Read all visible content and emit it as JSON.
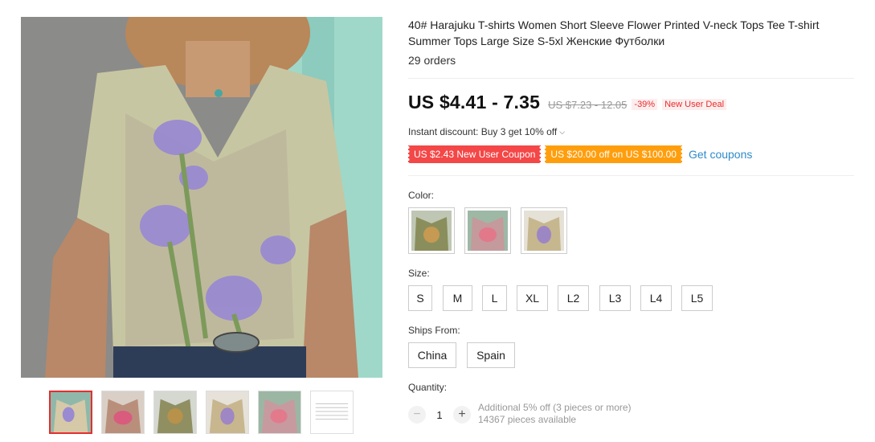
{
  "product": {
    "title": "40# Harajuku T-shirts Women Short Sleeve Flower Printed V-neck Tops Tee T-shirt Summer Tops Large Size S-5xl Женские Футболки",
    "orders": "29 orders"
  },
  "price": {
    "current": "US $4.41 - 7.35",
    "original": "US $7.23 - 12.05",
    "discount": "-39%",
    "deal": "New User Deal"
  },
  "instant_discount": "Instant discount: Buy 3 get 10% off",
  "coupons": {
    "new_user": "US $2.43 New User Coupon",
    "store": "US $20.00 off on US $100.00",
    "get_label": "Get coupons"
  },
  "color": {
    "label": "Color:"
  },
  "size": {
    "label": "Size:",
    "options": [
      "S",
      "M",
      "L",
      "XL",
      "L2",
      "L3",
      "L4",
      "L5"
    ]
  },
  "ships_from": {
    "label": "Ships From:",
    "options": [
      "China",
      "Spain"
    ]
  },
  "quantity": {
    "label": "Quantity:",
    "value": "1",
    "minus": "−",
    "plus": "+",
    "additional": "Additional 5% off (3 pieces or more)",
    "available": "14367 pieces available"
  },
  "colors": {
    "accent_red": "#e62e2e",
    "coupon_red": "#f44747",
    "coupon_orange": "#ff9e0d",
    "link_blue": "#2e8bc9"
  }
}
